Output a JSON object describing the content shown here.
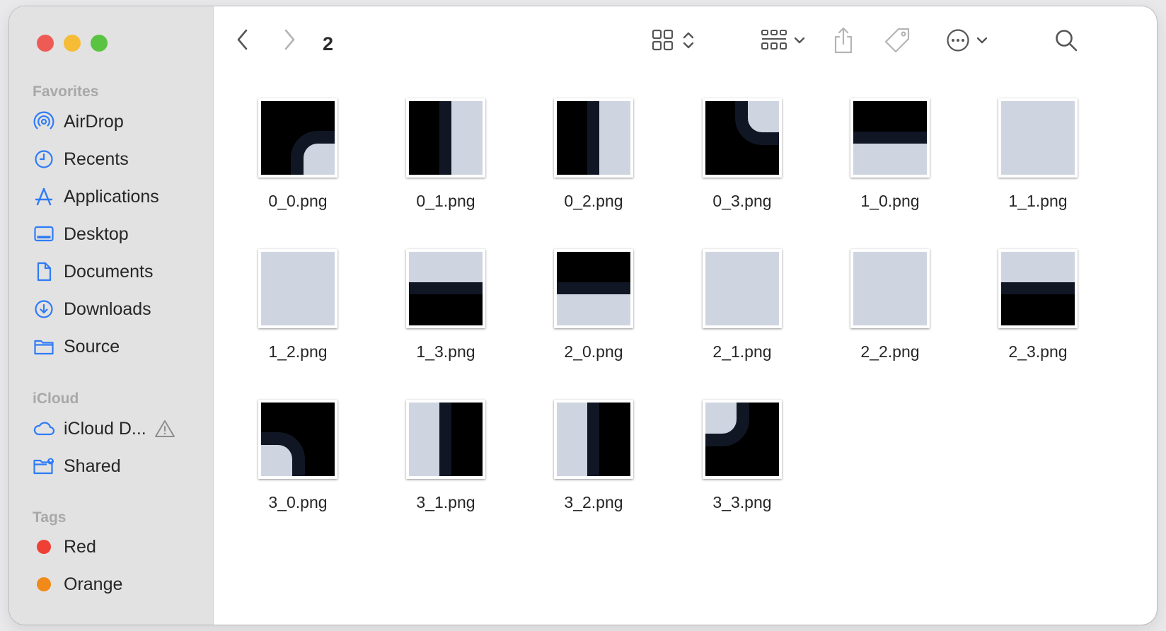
{
  "window": {
    "folder_title": "2"
  },
  "sidebar": {
    "favorites_title": "Favorites",
    "favorites": [
      {
        "label": "AirDrop",
        "icon": "airdrop-icon"
      },
      {
        "label": "Recents",
        "icon": "clock-icon"
      },
      {
        "label": "Applications",
        "icon": "applications-icon"
      },
      {
        "label": "Desktop",
        "icon": "desktop-icon"
      },
      {
        "label": "Documents",
        "icon": "document-icon"
      },
      {
        "label": "Downloads",
        "icon": "download-icon"
      },
      {
        "label": "Source",
        "icon": "folder-icon"
      }
    ],
    "icloud_title": "iCloud",
    "icloud": [
      {
        "label": "iCloud D...",
        "icon": "cloud-icon",
        "warning_icon": "warning-icon"
      },
      {
        "label": "Shared",
        "icon": "shared-folder-icon"
      }
    ],
    "tags_title": "Tags",
    "tags": [
      {
        "label": "Red",
        "color": "#ee4035"
      },
      {
        "label": "Orange",
        "color": "#f18a18"
      }
    ]
  },
  "toolbar": {
    "back": "chevron-left-icon",
    "forward": "chevron-right-icon",
    "view": "icon-grid-view-icon",
    "group": "group-by-icon",
    "share": "share-icon",
    "tag": "tag-icon",
    "more": "ellipsis-circle-icon",
    "search": "search-icon"
  },
  "colors": {
    "tile_dark": "#000000",
    "tile_light": "#cfd5e0",
    "tile_line": "#111625",
    "accent": "#2e7cf6"
  },
  "files": [
    {
      "name": "0_0.png",
      "pattern": "corner-br"
    },
    {
      "name": "0_1.png",
      "pattern": "vertical-light-right"
    },
    {
      "name": "0_2.png",
      "pattern": "vertical-light-right"
    },
    {
      "name": "0_3.png",
      "pattern": "corner-tr"
    },
    {
      "name": "1_0.png",
      "pattern": "horizontal-light-bottom"
    },
    {
      "name": "1_1.png",
      "pattern": "solid-light"
    },
    {
      "name": "1_2.png",
      "pattern": "solid-light"
    },
    {
      "name": "1_3.png",
      "pattern": "horizontal-light-top"
    },
    {
      "name": "2_0.png",
      "pattern": "horizontal-light-bottom"
    },
    {
      "name": "2_1.png",
      "pattern": "solid-light"
    },
    {
      "name": "2_2.png",
      "pattern": "solid-light"
    },
    {
      "name": "2_3.png",
      "pattern": "horizontal-light-top"
    },
    {
      "name": "3_0.png",
      "pattern": "corner-bl"
    },
    {
      "name": "3_1.png",
      "pattern": "vertical-light-left"
    },
    {
      "name": "3_2.png",
      "pattern": "vertical-light-left"
    },
    {
      "name": "3_3.png",
      "pattern": "corner-tl"
    }
  ]
}
